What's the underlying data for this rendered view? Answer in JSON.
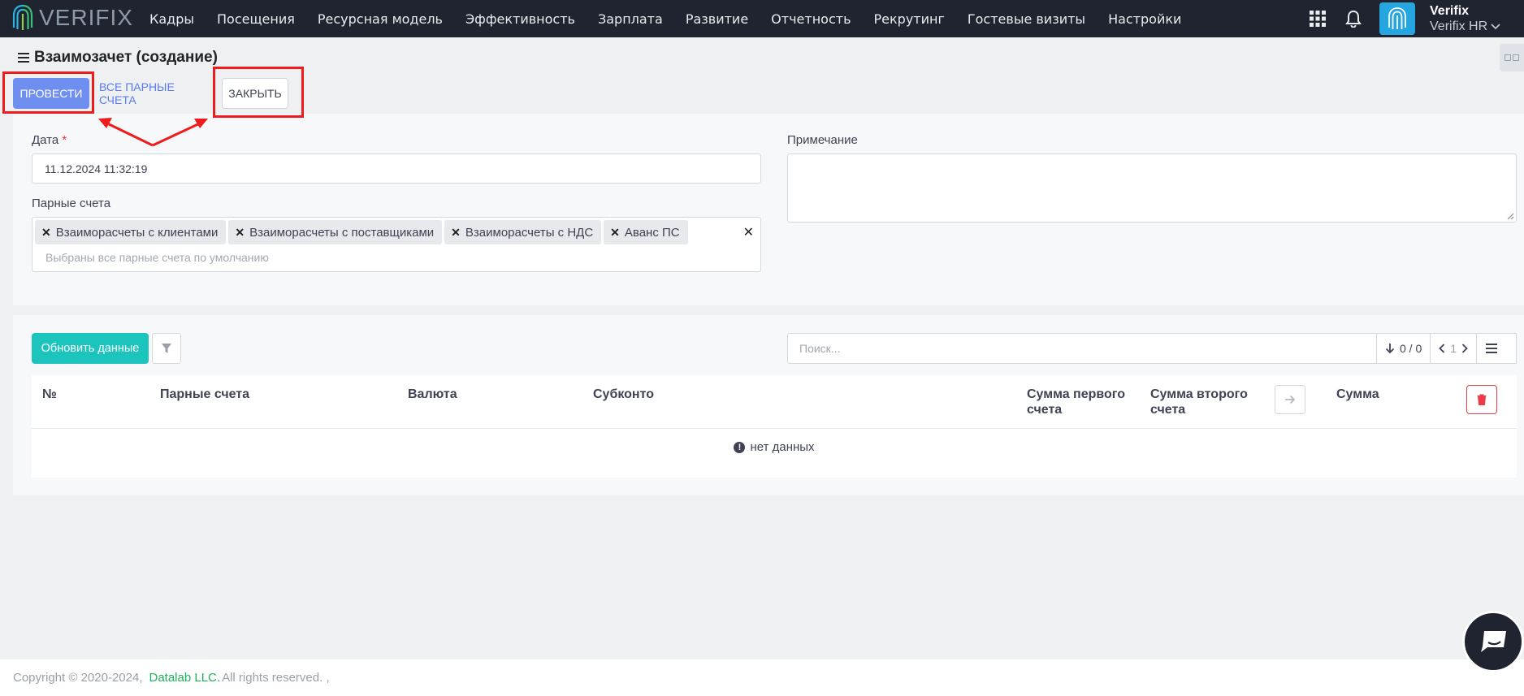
{
  "brand": {
    "logo_text": "VERIFIX"
  },
  "nav": {
    "items": [
      "Кадры",
      "Посещения",
      "Ресурсная модель",
      "Эффективность",
      "Зарплата",
      "Развитие",
      "Отчетность",
      "Рекрутинг",
      "Гостевые визиты",
      "Настройки"
    ]
  },
  "user": {
    "name": "Verifix",
    "org": "Verifix HR"
  },
  "page": {
    "title": "Взаимозачет (создание)"
  },
  "toolbar": {
    "post_label": "ПРОВЕСТИ",
    "all_pairs_label": "ВСЕ ПАРНЫЕ СЧЕТА",
    "close_label": "ЗАКРЫТЬ"
  },
  "form": {
    "date_label": "Дата",
    "date_required_mark": "*",
    "date_value": "11.12.2024 11:32:19",
    "note_label": "Примечание",
    "note_value": "",
    "pairs_label": "Парные счета",
    "pairs_chips": [
      "Взаиморасчеты с клиентами",
      "Взаиморасчеты с поставщиками",
      "Взаиморасчеты с НДС",
      "Аванс ПС"
    ],
    "pairs_placeholder": "Выбраны все парные счета по умолчанию"
  },
  "grid": {
    "refresh_label": "Обновить данные",
    "search_placeholder": "Поиск...",
    "count": "0 / 0",
    "page": "1",
    "columns": {
      "num": "№",
      "pairs": "Парные счета",
      "currency": "Валюта",
      "subconto": "Субконто",
      "sum_first": "Сумма первого счета",
      "sum_second": "Сумма второго счета",
      "sum": "Сумма"
    },
    "empty_text": "нет данных"
  },
  "footer": {
    "copyright": "Copyright © 2020-2024,",
    "company": "Datalab LLC.",
    "rights": "All rights reserved. ,"
  },
  "colors": {
    "primary": "#6f8ff0",
    "teal": "#1bc5bd",
    "danger": "#ee3b47",
    "annotation": "#ee1c1c",
    "topbar": "#1f2430"
  }
}
